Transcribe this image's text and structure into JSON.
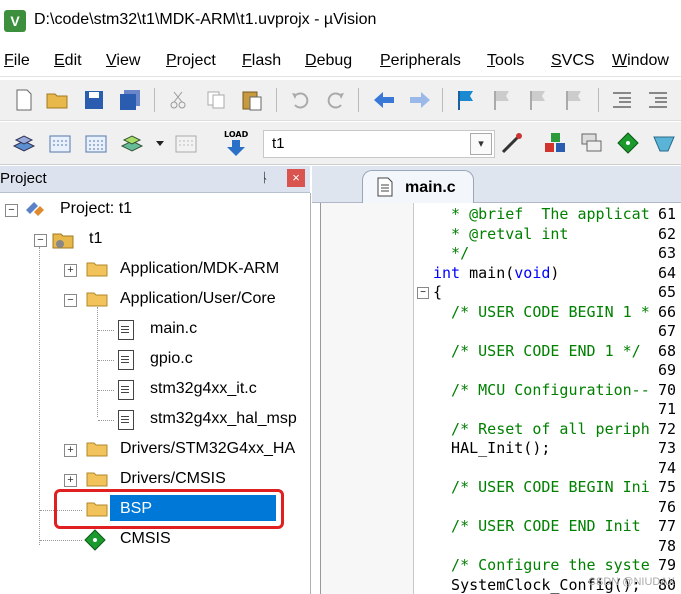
{
  "window": {
    "title": "D:\\code\\stm32\\t1\\MDK-ARM\\t1.uvprojx - µVision",
    "app_icon_text": "V"
  },
  "menu": [
    "File",
    "Edit",
    "View",
    "Project",
    "Flash",
    "Debug",
    "Peripherals",
    "Tools",
    "SVCS",
    "Window"
  ],
  "toolbar2": {
    "load_label": "LOAD",
    "target": "t1"
  },
  "project_panel": {
    "header": "Project",
    "pin": "ᚿ",
    "close": "×",
    "tree": {
      "root": "Project: t1",
      "target": "t1",
      "groups": [
        "Application/MDK-ARM",
        "Application/User/Core",
        "Drivers/STM32G4xx_HA",
        "Drivers/CMSIS",
        "BSP",
        "CMSIS"
      ],
      "core_files": [
        "main.c",
        "gpio.c",
        "stm32g4xx_it.c",
        "stm32g4xx_hal_msp"
      ]
    }
  },
  "editor": {
    "tab": "main.c",
    "lines": [
      {
        "n": "61",
        "t": "  * @brief  The applicat",
        "c": "cm"
      },
      {
        "n": "62",
        "t": "  * @retval int",
        "c": "cm"
      },
      {
        "n": "63",
        "t": "  */",
        "c": "cm"
      },
      {
        "n": "64",
        "t": "int main(void)",
        "c": "kw"
      },
      {
        "n": "65",
        "t": "{",
        "c": ""
      },
      {
        "n": "66",
        "t": "  /* USER CODE BEGIN 1 *",
        "c": "cm"
      },
      {
        "n": "67",
        "t": "",
        "c": ""
      },
      {
        "n": "68",
        "t": "  /* USER CODE END 1 */",
        "c": "cm"
      },
      {
        "n": "69",
        "t": "",
        "c": ""
      },
      {
        "n": "70",
        "t": "  /* MCU Configuration--",
        "c": "cm"
      },
      {
        "n": "71",
        "t": "",
        "c": ""
      },
      {
        "n": "72",
        "t": "  /* Reset of all periph",
        "c": "cm"
      },
      {
        "n": "73",
        "t": "  HAL_Init();",
        "c": ""
      },
      {
        "n": "74",
        "t": "",
        "c": ""
      },
      {
        "n": "75",
        "t": "  /* USER CODE BEGIN Ini",
        "c": "cm"
      },
      {
        "n": "76",
        "t": "",
        "c": ""
      },
      {
        "n": "77",
        "t": "  /* USER CODE END Init",
        "c": "cm"
      },
      {
        "n": "78",
        "t": "",
        "c": ""
      },
      {
        "n": "79",
        "t": "  /* Configure the syste",
        "c": "cm"
      },
      {
        "n": "80",
        "t": "  SystemClock_Config();",
        "c": ""
      }
    ]
  },
  "watermark": "CSDN @NIUDAX"
}
